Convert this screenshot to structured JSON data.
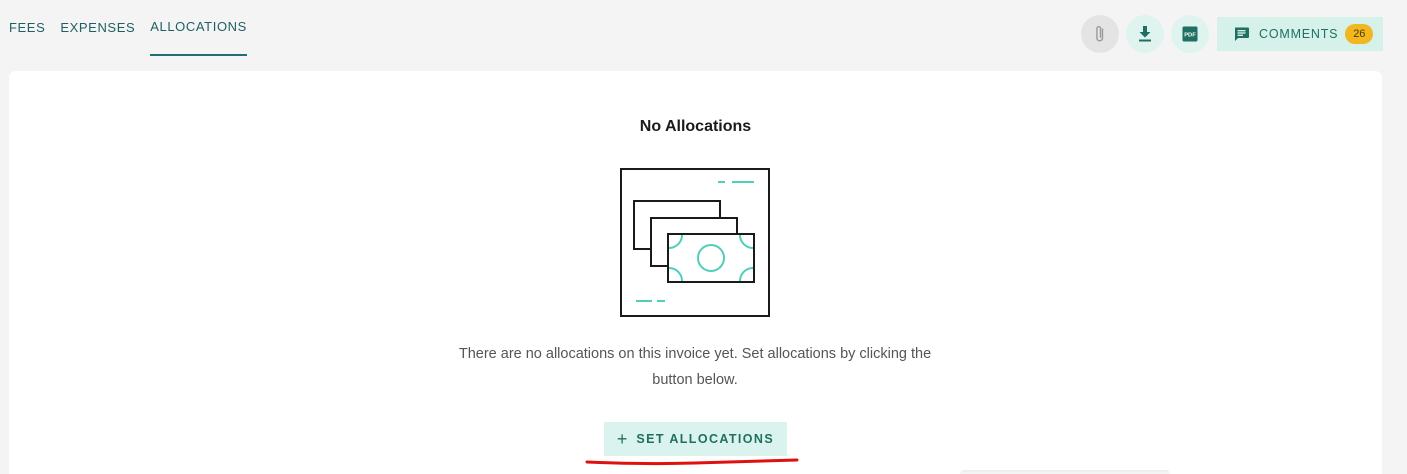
{
  "tabs": [
    {
      "label": "FEES",
      "active": false
    },
    {
      "label": "EXPENSES",
      "active": false
    },
    {
      "label": "ALLOCATIONS",
      "active": true
    }
  ],
  "toolbar": {
    "attachment_icon": "paperclip-icon",
    "download_icon": "download-icon",
    "pdf_icon": "pdf-icon",
    "pdf_icon_text": "PDF",
    "comments_label": "COMMENTS",
    "comments_count": "26"
  },
  "empty_state": {
    "title": "No Allocations",
    "message": "There are no allocations on this invoice yet. Set allocations by clicking the button below.",
    "illustration": "money-bills-illustration",
    "button_label": "SET ALLOCATIONS",
    "button_icon": "plus-icon"
  },
  "colors": {
    "accent": "#1f6f63",
    "accent_light": "#daf3ee",
    "illustration_teal": "#4fcfb7",
    "badge": "#f2b61e",
    "annotation_red": "#e01010"
  }
}
